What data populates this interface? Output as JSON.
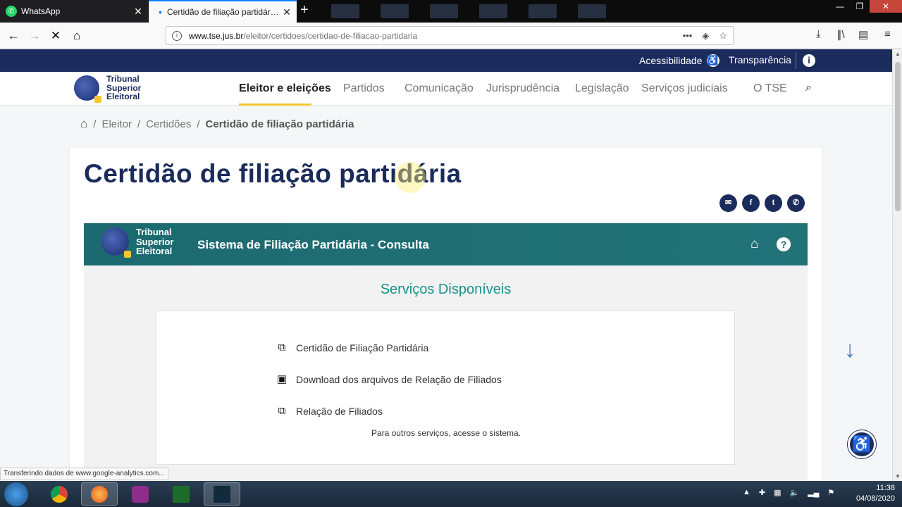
{
  "browser": {
    "tabs": [
      {
        "title": "WhatsApp",
        "active": false
      },
      {
        "title": "Certidão de filiação partidária -",
        "active": true
      }
    ],
    "url_domain": "www.tse.jus.br",
    "url_path": "/eleitor/certidoes/certidao-de-filiacao-partidaria",
    "status_text": "Transferindo dados de www.google-analytics.com..."
  },
  "topbar": {
    "accessibility_label": "Acessibilidade",
    "transparency_label": "Transparência"
  },
  "logo": {
    "line1": "Tribunal",
    "line2": "Superior",
    "line3": "Eleitoral"
  },
  "mainnav": {
    "items": [
      "Eleitor e eleições",
      "Partidos",
      "Comunicação",
      "Jurisprudência",
      "Legislação",
      "Serviços judiciais",
      "O TSE"
    ]
  },
  "breadcrumb": {
    "items": [
      "Eleitor",
      "Certidões",
      "Certidão de filiação partidária"
    ]
  },
  "page": {
    "title": "Certidão de filiação partidária"
  },
  "system": {
    "title": "Sistema de Filiação Partidária - Consulta",
    "services_heading": "Serviços Disponíveis",
    "services": [
      {
        "label": "Certidão de Filiação Partidária",
        "icon": "external-link-icon"
      },
      {
        "label": "Download dos arquivos de Relação de Filiados",
        "icon": "archive-icon"
      },
      {
        "label": "Relação de Filiados",
        "icon": "external-link-icon"
      }
    ],
    "note": "Para outros serviços, acesse o sistema."
  },
  "taskbar": {
    "time": "11:38",
    "date": "04/08/2020"
  },
  "colors": {
    "navy": "#1b2b5c",
    "teal": "#1f6e73",
    "accent_yellow": "#f6c62f",
    "services_heading": "#17918a"
  }
}
